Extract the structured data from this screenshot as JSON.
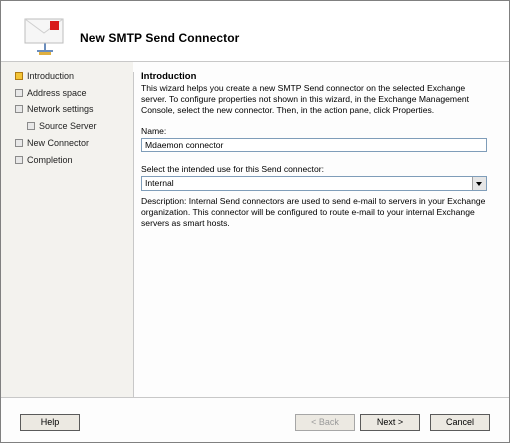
{
  "window": {
    "title": "New SMTP Send Connector"
  },
  "nav": [
    {
      "label": "Introduction",
      "active": true
    },
    {
      "label": "Address space",
      "active": false
    },
    {
      "label": "Network settings",
      "active": false
    },
    {
      "label": "Source Server",
      "active": false
    },
    {
      "label": "New Connector",
      "active": false
    },
    {
      "label": "Completion",
      "active": false
    }
  ],
  "content": {
    "heading": "Introduction",
    "intro": "This wizard helps you create a new SMTP Send connector on the selected Exchange server. To configure properties not shown in this wizard, in the Exchange Management Console, select the new connector. Then, in the action pane, click Properties.",
    "name_label": "Name:",
    "name_value": "Mdaemon connector",
    "use_label": "Select the intended use for this Send connector:",
    "use_value": "Internal",
    "description": "Description: Internal Send connectors are used to send e-mail to servers in your Exchange organization. This connector will be configured to route e-mail to your internal Exchange servers as smart hosts."
  },
  "buttons": {
    "help": "Help",
    "back": "< Back",
    "next": "Next >",
    "cancel": "Cancel"
  },
  "colors": {
    "active_step": "#f4c436",
    "border_blue": "#7f9db9"
  },
  "icons": [
    "wizard-envelope-icon"
  ]
}
